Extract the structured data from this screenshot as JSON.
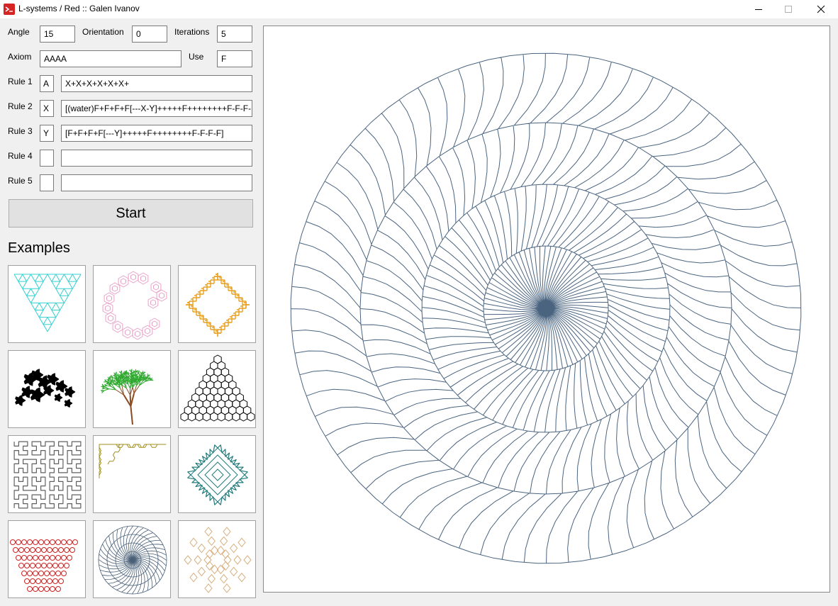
{
  "window": {
    "title": "L-systems / Red :: Galen Ivanov"
  },
  "params": {
    "angle_label": "Angle",
    "angle_value": "15",
    "orientation_label": "Orientation",
    "orientation_value": "0",
    "iterations_label": "Iterations",
    "iterations_value": "5",
    "axiom_label": "Axiom",
    "axiom_value": "AAAA",
    "use_label": "Use",
    "use_value": "F"
  },
  "rules": [
    {
      "label": "Rule 1",
      "symbol": "A",
      "production": "X+X+X+X+X+X+"
    },
    {
      "label": "Rule 2",
      "symbol": "X",
      "production": "[(water)F+F+F+F[---X-Y]+++++F++++++++F-F-F-F]"
    },
    {
      "label": "Rule 3",
      "symbol": "Y",
      "production": "[F+F+F+F[---Y]+++++F++++++++F-F-F-F]"
    },
    {
      "label": "Rule 4",
      "symbol": "",
      "production": ""
    },
    {
      "label": "Rule 5",
      "symbol": "",
      "production": ""
    }
  ],
  "start_label": "Start",
  "examples_label": "Examples",
  "examples": [
    {
      "icon": "sierpinski-arrowhead-icon",
      "color": "#35d0d0"
    },
    {
      "icon": "hexagon-c-curve-icon",
      "color": "#e8a0c8"
    },
    {
      "icon": "cross-snowflake-icon",
      "color": "#e8a020"
    },
    {
      "icon": "dragon-curve-icon",
      "color": "#000000"
    },
    {
      "icon": "tree-icon",
      "color": "#2ea82e"
    },
    {
      "icon": "hexagon-triangle-icon",
      "color": "#000000"
    },
    {
      "icon": "hilbert-curve-icon",
      "color": "#606060"
    },
    {
      "icon": "gosper-curve-icon",
      "color": "#a09020"
    },
    {
      "icon": "quadratic-island-icon",
      "color": "#207a7a"
    },
    {
      "icon": "triangle-pattern-icon",
      "color": "#d02020"
    },
    {
      "icon": "spiral-disc-icon",
      "color": "#4a6078"
    },
    {
      "icon": "penrose-tiling-icon",
      "color": "#d8b080"
    }
  ],
  "canvas": {
    "stroke_color": "#4a6480"
  }
}
